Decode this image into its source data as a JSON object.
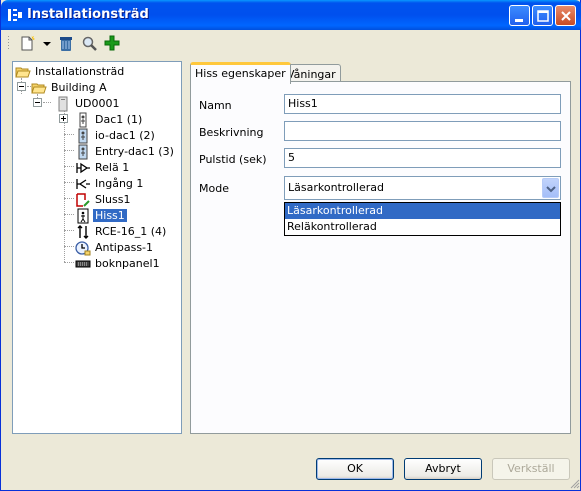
{
  "window": {
    "title": "Installationsträd"
  },
  "toolbar": {
    "items": [
      {
        "name": "new-icon"
      },
      {
        "name": "dropdown-arrow-icon"
      },
      {
        "name": "delete-icon"
      },
      {
        "name": "search-icon"
      },
      {
        "name": "add-icon"
      }
    ]
  },
  "tree": {
    "root": "Installationsträd",
    "building": "Building A",
    "unit": "UD0001",
    "items": [
      {
        "label": "Dac1 (1)",
        "icon": "door-controller-icon"
      },
      {
        "label": "io-dac1 (2)",
        "icon": "io-controller-icon"
      },
      {
        "label": "Entry-dac1 (3)",
        "icon": "entry-controller-icon"
      },
      {
        "label": "Relä 1",
        "icon": "relay-icon"
      },
      {
        "label": "Ingång 1",
        "icon": "input-icon"
      },
      {
        "label": "Sluss1",
        "icon": "airlock-icon"
      },
      {
        "label": "Hiss1",
        "icon": "elevator-icon"
      },
      {
        "label": "RCE-16_1 (4)",
        "icon": "rce-icon"
      },
      {
        "label": "Antipass-1",
        "icon": "antipass-icon"
      },
      {
        "label": "boknpanel1",
        "icon": "booking-panel-icon"
      }
    ],
    "selected": "Hiss1"
  },
  "tabs": [
    {
      "label": "Hiss egenskaper",
      "active": true
    },
    {
      "label": "Våningar",
      "active": false
    }
  ],
  "form": {
    "name_label": "Namn",
    "name_value": "Hiss1",
    "description_label": "Beskrivning",
    "description_value": "",
    "pulse_label": "Pulstid (sek)",
    "pulse_value": "5",
    "mode_label": "Mode",
    "mode_value": "Läsarkontrollerad",
    "mode_options": [
      "Läsarkontrollerad",
      "Reläkontrollerad"
    ]
  },
  "buttons": {
    "ok": "OK",
    "cancel": "Avbryt",
    "apply": "Verkställ"
  },
  "colors": {
    "titlebar": "#0053ee",
    "selection": "#316ac5",
    "active_tab_accent": "#ffc83c"
  }
}
